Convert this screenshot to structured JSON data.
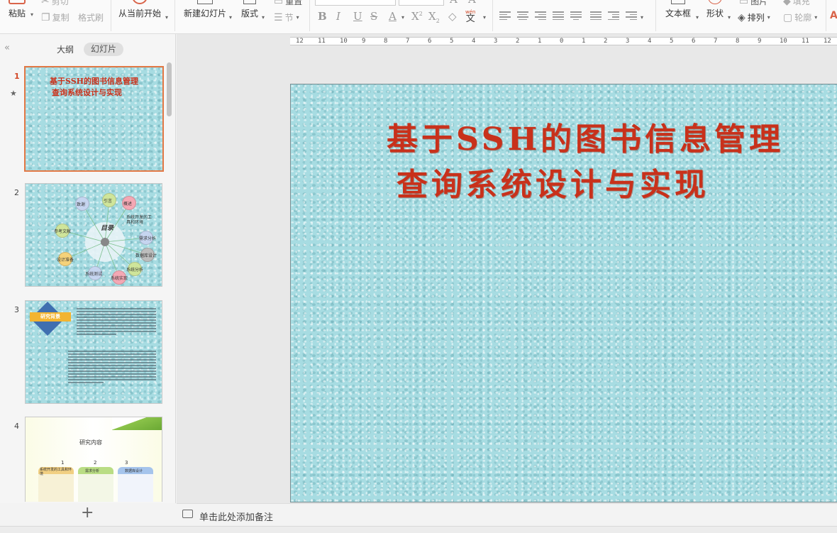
{
  "ribbon": {
    "paste": "粘贴",
    "cut": "剪切",
    "copy": "复制",
    "format_painter": "格式刷",
    "from_current": "从当前开始",
    "new_slide": "新建幻灯片",
    "layout": "版式",
    "section": "节",
    "reset": "重置",
    "textbox": "文本框",
    "shape": "形状",
    "arrange": "排列",
    "image": "图片",
    "fill": "填充",
    "outline": "轮廓",
    "pinyin_glyph_top": "wén",
    "pinyin_glyph": "文"
  },
  "left_panel": {
    "tab_outline": "大纲",
    "tab_slides": "幻灯片",
    "thumbnails": [
      {
        "number": "1",
        "title_line1": "基于SSH的图书信息管理",
        "title_line2": "查询系统设计与实现"
      },
      {
        "number": "2",
        "center_label": "目录",
        "bubbles": [
          "致谢",
          "引言",
          "概述",
          "参考文献",
          "需求分析",
          "数据库设计",
          "设计准备",
          "系统测试",
          "系统实现",
          "系统分析"
        ],
        "side_note": "系统开发的工具和环境"
      },
      {
        "number": "3",
        "badge": "研究背景"
      },
      {
        "number": "4",
        "heading": "研究内容",
        "steps": [
          "1",
          "2",
          "3"
        ],
        "cards": [
          "系统开发的工具和环境",
          "需求分析",
          "数据库设计"
        ]
      }
    ]
  },
  "ruler": [
    "12",
    "11",
    "10",
    "9",
    "8",
    "7",
    "6",
    "5",
    "4",
    "3",
    "2",
    "1",
    "0",
    "1",
    "2",
    "3",
    "4",
    "5",
    "6",
    "7",
    "8",
    "9",
    "10",
    "11",
    "12"
  ],
  "slide": {
    "title_line1": "基于SSH的图书信息管理",
    "title_line2": "查询系统设计与实现"
  },
  "notes": {
    "placeholder": "单击此处添加备注"
  }
}
